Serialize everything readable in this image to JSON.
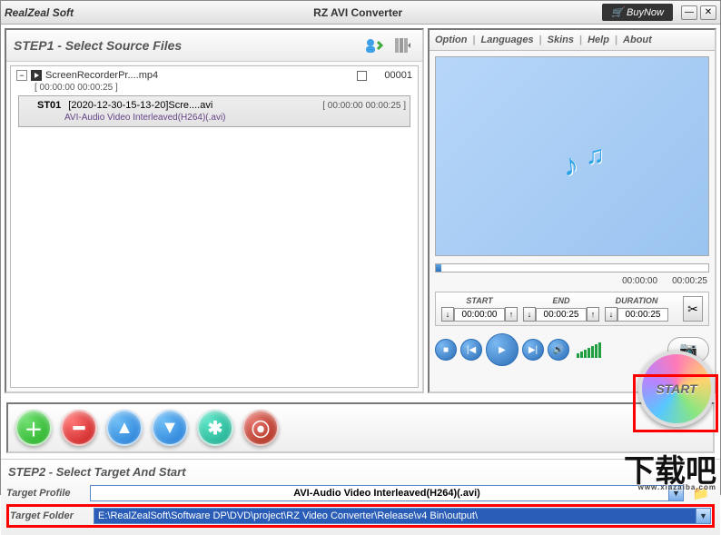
{
  "titlebar": {
    "brand": "RealZeal Soft",
    "app": "RZ AVI Converter",
    "buynow": "BuyNow"
  },
  "menu": {
    "option": "Option",
    "languages": "Languages",
    "skins": "Skins",
    "help": "Help",
    "about": "About"
  },
  "step1": {
    "title": "STEP1 - Select Source Files",
    "parent": {
      "name": "ScreenRecorderPr....mp4",
      "dur": "[ 00:00:00  00:00:25 ]",
      "index": "00001"
    },
    "child": {
      "tag": "ST01",
      "name": "[2020-12-30-15-13-20]Scre....avi",
      "time": "[ 00:00:00  00:00:25 ]",
      "codec": "AVI-Audio Video Interleaved(H264)(.avi)"
    }
  },
  "preview": {
    "time_cur": "00:00:00",
    "time_total": "00:00:25"
  },
  "trim": {
    "start_label": "START",
    "end_label": "END",
    "dur_label": "DURATION",
    "start": "00:00:00",
    "end": "00:00:25",
    "dur": "00:00:25"
  },
  "step2": {
    "title": "STEP2 - Select Target And Start",
    "profile_label": "Target Profile",
    "profile_value": "AVI-Audio Video Interleaved(H264)(.avi)",
    "folder_label": "Target Folder",
    "folder_value": "E:\\RealZealSoft\\Software DP\\DVD\\project\\RZ Video Converter\\Release\\v4 Bin\\output\\"
  },
  "start_label": "START",
  "watermark": {
    "big": "下载吧",
    "small": "www.xiazaiba.com"
  }
}
